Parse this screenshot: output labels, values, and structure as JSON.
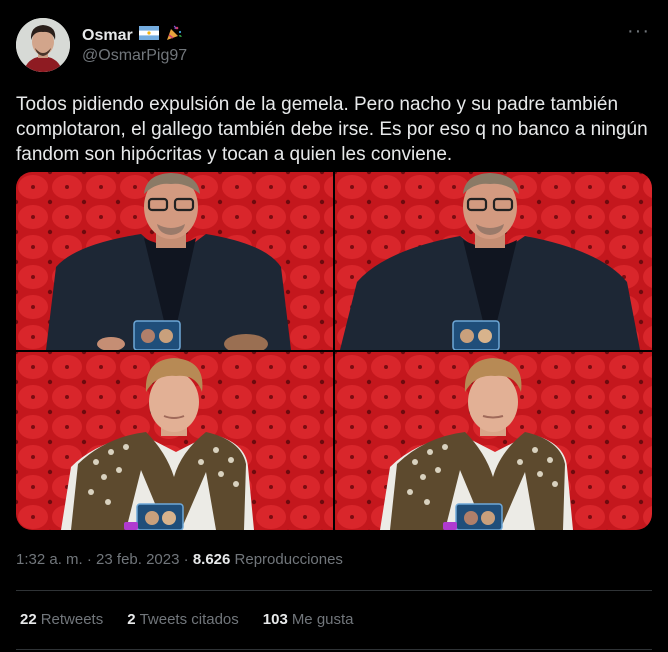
{
  "author": {
    "display_name": "Osmar",
    "handle": "@OsmarPig97",
    "badges": [
      "argentina-flag-icon",
      "party-popper-icon"
    ]
  },
  "more_icon": "more-options-icon",
  "tweet": {
    "text": "Todos pidiendo expulsión de la gemela. Pero nacho y su padre también complotaron, el gallego también debe irse. Es por eso q no banco a ningún fandom son hipócritas y tocan a quien les conviene."
  },
  "media": {
    "frames": [
      "man-in-suit-frame-1",
      "man-in-suit-frame-2",
      "young-man-frame-1",
      "young-man-frame-2"
    ]
  },
  "meta": {
    "time": "1:32 a. m.",
    "separator": "·",
    "date": "23 feb. 2023",
    "views_count": "8.626",
    "views_label": "Reproducciones"
  },
  "stats": {
    "retweets_count": "22",
    "retweets_label": "Retweets",
    "quotes_count": "2",
    "quotes_label": "Tweets citados",
    "likes_count": "103",
    "likes_label": "Me gusta"
  },
  "colors": {
    "background": "#000000",
    "text": "#e7e9ea",
    "secondary": "#71767b",
    "divider": "#2f3336",
    "studio_red": "#c4171d"
  }
}
